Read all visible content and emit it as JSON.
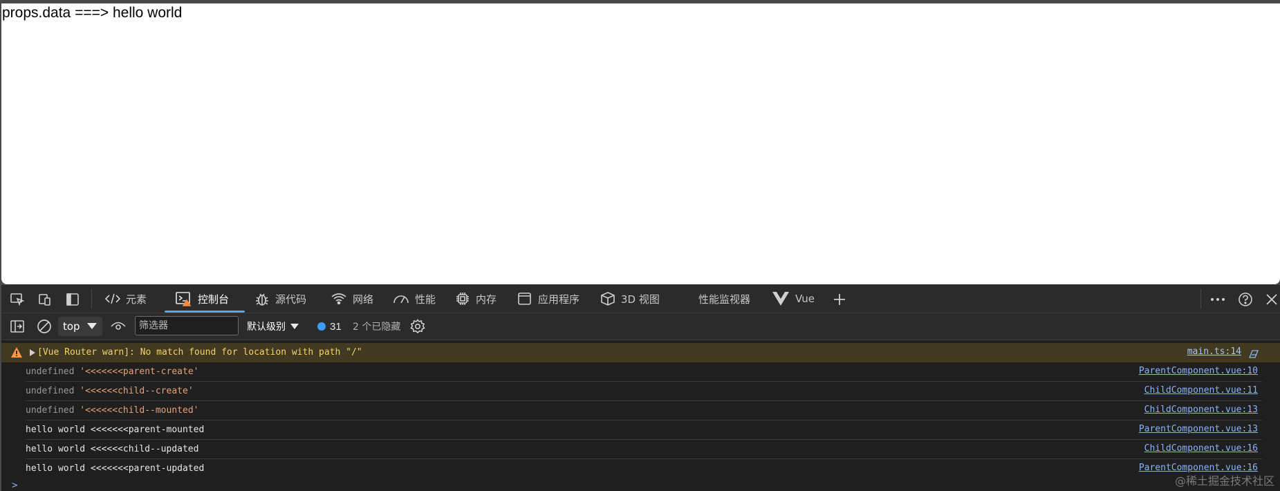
{
  "page": {
    "text": "props.data ===> hello world"
  },
  "devtools": {
    "tabs": [
      {
        "label": "元素",
        "icon": "code-icon"
      },
      {
        "label": "控制台",
        "icon": "console-icon"
      },
      {
        "label": "源代码",
        "icon": "bug-icon"
      },
      {
        "label": "网络",
        "icon": "wifi-icon"
      },
      {
        "label": "性能",
        "icon": "gauge-icon"
      },
      {
        "label": "内存",
        "icon": "chip-icon"
      },
      {
        "label": "应用程序",
        "icon": "window-icon"
      },
      {
        "label": "3D 视图",
        "icon": "cube-icon"
      },
      {
        "label": "性能监视器",
        "icon": ""
      },
      {
        "label": "Vue",
        "icon": "vue-logo-icon"
      }
    ],
    "toolbar": {
      "context": "top",
      "filter_placeholder": "筛选器",
      "level": "默认级别",
      "message_count": "31",
      "hidden": "2 个已隐藏"
    },
    "console": {
      "warning": {
        "text": "[Vue Router warn]: No match found for location with path \"/\"",
        "source": "main.ts:14"
      },
      "rows": [
        {
          "prefix": "undefined ",
          "value": "'<<<<<<<parent-create'",
          "source": "ParentComponent.vue:10"
        },
        {
          "prefix": "undefined ",
          "value": "'<<<<<<child--create'",
          "source": "ChildComponent.vue:11"
        },
        {
          "prefix": "undefined ",
          "value": "'<<<<<<child--mounted'",
          "source": "ChildComponent.vue:13"
        },
        {
          "text": "hello world <<<<<<<parent-mounted",
          "source": "ParentComponent.vue:13"
        },
        {
          "text": "hello world <<<<<<child--updated",
          "source": "ChildComponent.vue:16"
        },
        {
          "text": "hello world <<<<<<<parent-updated",
          "source": "ParentComponent.vue:16"
        }
      ],
      "prompt": ">"
    },
    "colors": {
      "accent": "#4aa3ff",
      "warning_bg": "#413a20",
      "warning_text": "#f5d26b",
      "link": "#8ab4f8"
    }
  },
  "watermark": "@稀土掘金技术社区"
}
